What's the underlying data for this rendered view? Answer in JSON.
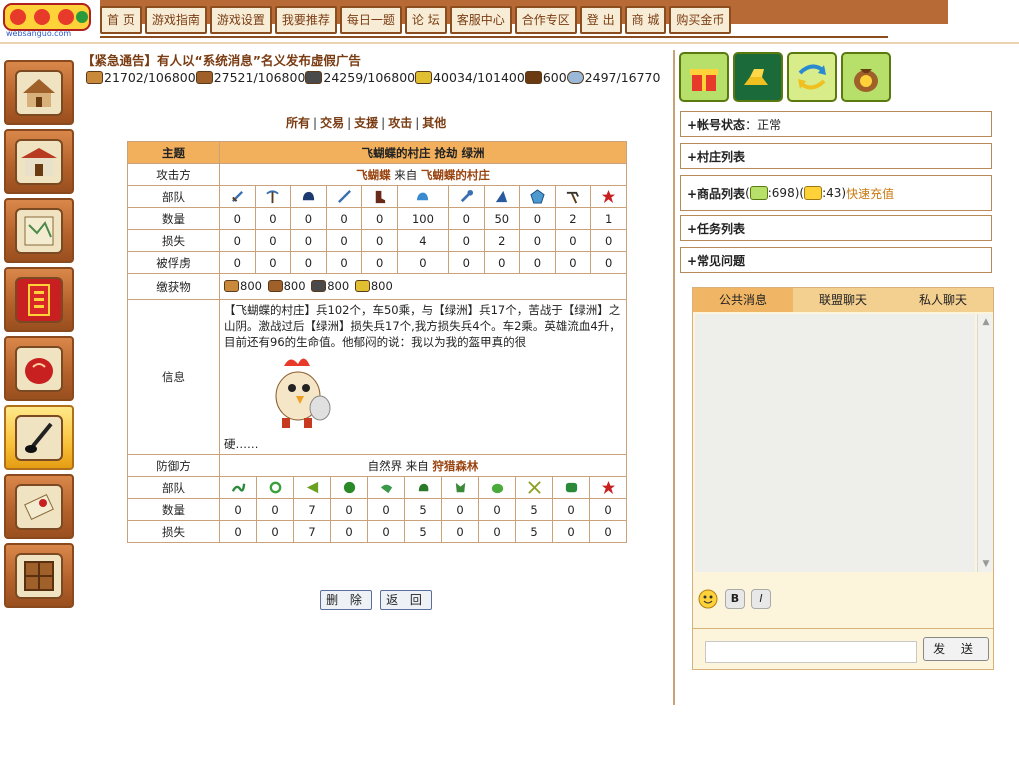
{
  "logo": {
    "domain_text": "websanguo.com"
  },
  "nav": [
    "首 页",
    "游戏指南",
    "游戏设置",
    "我要推荐",
    "每日一题",
    "论 坛",
    "客服中心",
    "合作专区",
    "登 出",
    "商 城",
    "购买金币"
  ],
  "notice": "【紧急通告】有人以“系统消息”名义发布虚假广告",
  "resources": [
    {
      "icon": "wood-icon",
      "color": "#c88a3a",
      "text": "21702/106800"
    },
    {
      "icon": "clay-icon",
      "color": "#a0602a",
      "text": "27521/106800"
    },
    {
      "icon": "iron-icon",
      "color": "#4a4a4a",
      "text": "24259/106800"
    },
    {
      "icon": "grain-icon",
      "color": "#e0c030",
      "text": "40034/101400"
    },
    {
      "icon": "food-bowl-icon",
      "color": "#6a3a10",
      "text": "600"
    },
    {
      "icon": "population-icon",
      "color": "#9ab8d8",
      "text": "2497/16770"
    }
  ],
  "filters": [
    "所有",
    "交易",
    "支援",
    "攻击",
    "其他"
  ],
  "report": {
    "subject_label": "主题",
    "subject_text": "飞蝴蝶的村庄 抢劫 绿洲",
    "attacker_label": "攻击方",
    "attacker_name": "飞蝴蝶",
    "attacker_from": "来自",
    "attacker_village": "飞蝴蝶的村庄",
    "units_label": "部队",
    "count_label": "数量",
    "loss_label": "损失",
    "captured_label": "被俘虏",
    "attacker_units": [
      "sword-icon",
      "pickaxe-icon",
      "helmet-icon",
      "spear-icon",
      "boot-icon",
      "horse-helmet-icon",
      "wrench-icon",
      "catapult-icon",
      "shield-gem-icon",
      "hoe-icon",
      "hero-emblem-icon"
    ],
    "attacker_counts": [
      "0",
      "0",
      "0",
      "0",
      "0",
      "100",
      "0",
      "50",
      "0",
      "2",
      "1"
    ],
    "attacker_losses": [
      "0",
      "0",
      "0",
      "0",
      "0",
      "4",
      "0",
      "2",
      "0",
      "0",
      "0"
    ],
    "attacker_captured": [
      "0",
      "0",
      "0",
      "0",
      "0",
      "0",
      "0",
      "0",
      "0",
      "0",
      "0"
    ],
    "loot_label": "缴获物",
    "loot": [
      {
        "icon": "wood-icon",
        "color": "#c88a3a",
        "text": "800"
      },
      {
        "icon": "clay-icon",
        "color": "#a0602a",
        "text": "800"
      },
      {
        "icon": "iron-icon",
        "color": "#4a4a4a",
        "text": "800"
      },
      {
        "icon": "grain-icon",
        "color": "#e0c030",
        "text": "800"
      }
    ],
    "info_label": "信息",
    "info_text": "【飞蝴蝶的村庄】兵102个，车50乘，与【绿洲】兵17个，苦战于【绿洲】之山阴。激战过后【绿洲】损失兵17个,我方损失兵4个。车2乘。英雄流血4升，目前还有96的生命值。他郁闷的说：我以为我的盔甲真的很",
    "info_tail": "硬……",
    "defender_label": "防御方",
    "defender_name": "自然界",
    "defender_from": "来自",
    "defender_place": "狩猎森林",
    "defender_units": [
      "snake-icon",
      "ring-icon",
      "arrow-icon",
      "turtle-icon",
      "bird-icon",
      "boar-icon",
      "wolf-icon",
      "frog-icon",
      "crossed-swords-icon",
      "dragon-icon",
      "hero-emblem-icon"
    ],
    "defender_counts": [
      "0",
      "0",
      "7",
      "0",
      "0",
      "5",
      "0",
      "0",
      "5",
      "0",
      "0"
    ],
    "defender_losses": [
      "0",
      "0",
      "7",
      "0",
      "0",
      "5",
      "0",
      "0",
      "5",
      "0",
      "0"
    ]
  },
  "buttons": {
    "delete": "删 除",
    "back": "返 回"
  },
  "right": {
    "account_label": "+帐号状态",
    "account_value": "：正常",
    "village_list": "+村庄列表",
    "goods_label": "+商品列表",
    "goods_gift": ":698",
    "goods_gold": ":43",
    "recharge": "快速充值",
    "task_list": "+任务列表",
    "faq": "+常见问题"
  },
  "chat": {
    "tabs": [
      "公共消息",
      "联盟聊天",
      "私人聊天"
    ],
    "bold": "B",
    "italic": "I",
    "send": "发 送"
  }
}
